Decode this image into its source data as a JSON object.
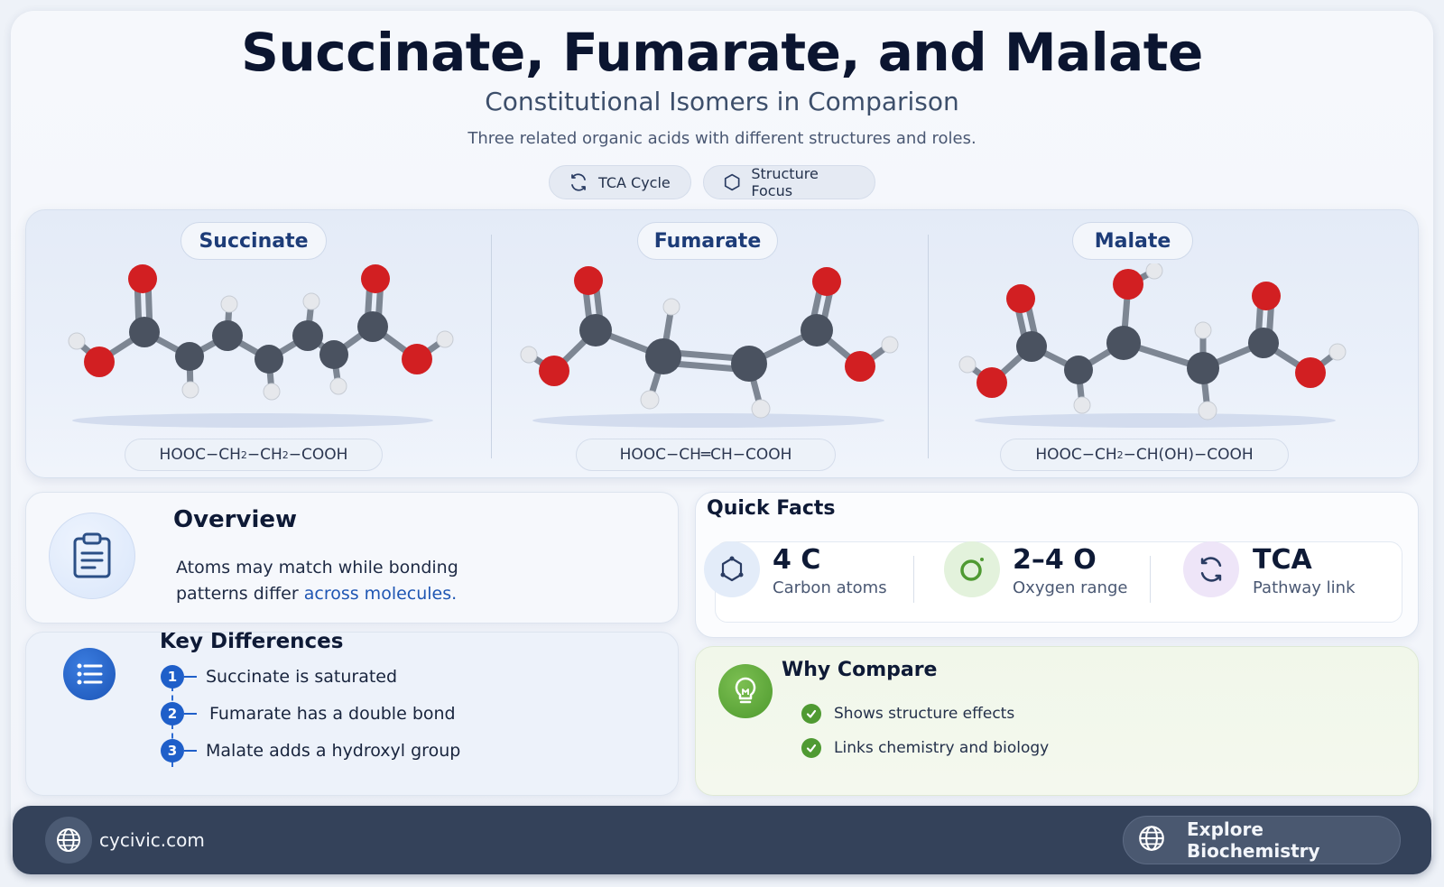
{
  "header": {
    "title": "Succinate, Fumarate, and Malate",
    "subtitle": "Constitutional Isomers in Comparison",
    "tagline": "Three related organic acids with different structures and roles."
  },
  "chips": [
    {
      "label": "TCA Cycle",
      "icon": "cycle-arrows-icon"
    },
    {
      "label": "Structure Focus",
      "icon": "hexagon-icon"
    }
  ],
  "molecules": [
    {
      "name": "Succinate",
      "formula_parts": [
        "HOOC−CH",
        "2",
        "−CH",
        "2",
        "−COOH"
      ]
    },
    {
      "name": "Fumarate",
      "formula_parts": [
        "HOOC−CH═CH−COOH"
      ]
    },
    {
      "name": "Malate",
      "formula_parts": [
        "HOOC−CH",
        "2",
        "−CH(OH)−COOH"
      ]
    }
  ],
  "overview": {
    "title": "Overview",
    "text_line1": "Atoms may match while bonding",
    "text_line2_prefix": "patterns differ ",
    "text_line2_highlight": "across molecules.",
    "icon": "clipboard-icon"
  },
  "key_differences": {
    "title": "Key Differences",
    "icon": "list-icon",
    "items": [
      {
        "num": "1",
        "text": "Succinate is saturated"
      },
      {
        "num": "2",
        "text": "Fumarate has a double bond"
      },
      {
        "num": "3",
        "text": "Malate adds a hydroxyl group"
      }
    ]
  },
  "quick_facts": {
    "title": "Quick Facts",
    "items": [
      {
        "value": "4 C",
        "label": "Carbon atoms",
        "icon": "molecule-icon"
      },
      {
        "value": "2–4 O",
        "label": "Oxygen range",
        "icon": "oxygen-icon"
      },
      {
        "value": "TCA",
        "label": "Pathway link",
        "icon": "cycle-arrows-icon"
      }
    ]
  },
  "why_compare": {
    "title": "Why Compare",
    "icon": "lightbulb-icon",
    "items": [
      "Shows structure effects",
      "Links chemistry and biology"
    ]
  },
  "footer": {
    "site": "cycivic.com",
    "button_label": "Explore Biochemistry"
  },
  "colors": {
    "carbon": "#4a5260",
    "oxygen": "#d21f22",
    "hydrogen": "#e6e8ec",
    "accent_blue": "#1f5fc9",
    "accent_green": "#4f9a32",
    "footer_bg": "#34425a"
  }
}
